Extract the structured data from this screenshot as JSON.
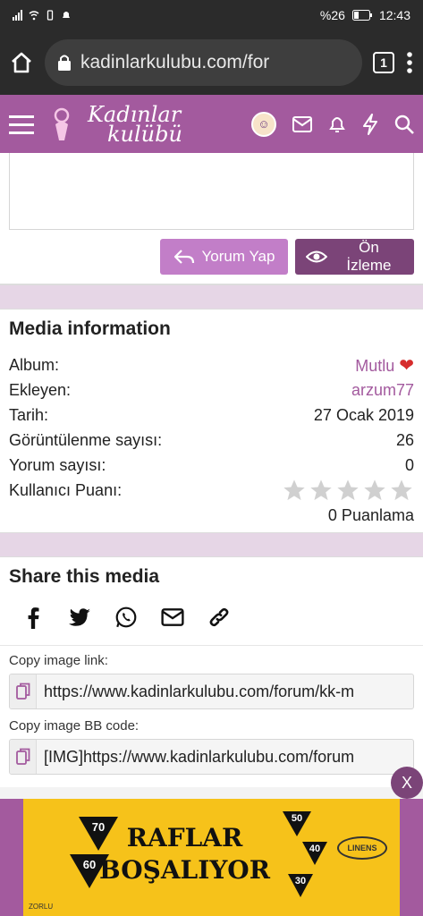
{
  "status_bar": {
    "battery": "%26",
    "time": "12:43"
  },
  "browser": {
    "url": "kadinlarkulubu.com/for",
    "tab_count": "1"
  },
  "header": {
    "logo_line1": "Kadınlar",
    "logo_line2": "kulübü"
  },
  "editor": {
    "reply_label": "Yorum Yap",
    "preview_label": "Ön İzleme"
  },
  "media_info": {
    "title": "Media information",
    "rows": [
      {
        "label": "Album:",
        "value": "Mutlu"
      },
      {
        "label": "Ekleyen:",
        "value": "arzum77"
      },
      {
        "label": "Tarih:",
        "value": "27 Ocak 2019"
      },
      {
        "label": "Görüntülenme sayısı:",
        "value": "26"
      },
      {
        "label": "Yorum sayısı:",
        "value": "0"
      },
      {
        "label": "Kullanıcı Puanı:",
        "value": ""
      }
    ],
    "rating_stars": 0,
    "ratings_count": "0 Puanlama"
  },
  "share": {
    "title": "Share this media"
  },
  "copy": {
    "image_link_label": "Copy image link:",
    "image_link_value": "https://www.kadinlarkulubu.com/forum/kk-m",
    "bb_code_label": "Copy image BB code:",
    "bb_code_value": "[IMG]https://www.kadinlarkulubu.com/forum"
  },
  "ad": {
    "headline_1": "RAFLAR",
    "headline_2": "BOŞALIYOR",
    "brand": "LINENS",
    "footer": "ZORLU",
    "discounts": [
      "70",
      "60",
      "50",
      "40",
      "30"
    ],
    "close_label": "X"
  },
  "colors": {
    "brand": "#a35a9e",
    "brand_dark": "#7b4478",
    "reply_button": "#c27ec8",
    "separator": "#e6d6e6",
    "ad_yellow": "#f6c21a"
  }
}
